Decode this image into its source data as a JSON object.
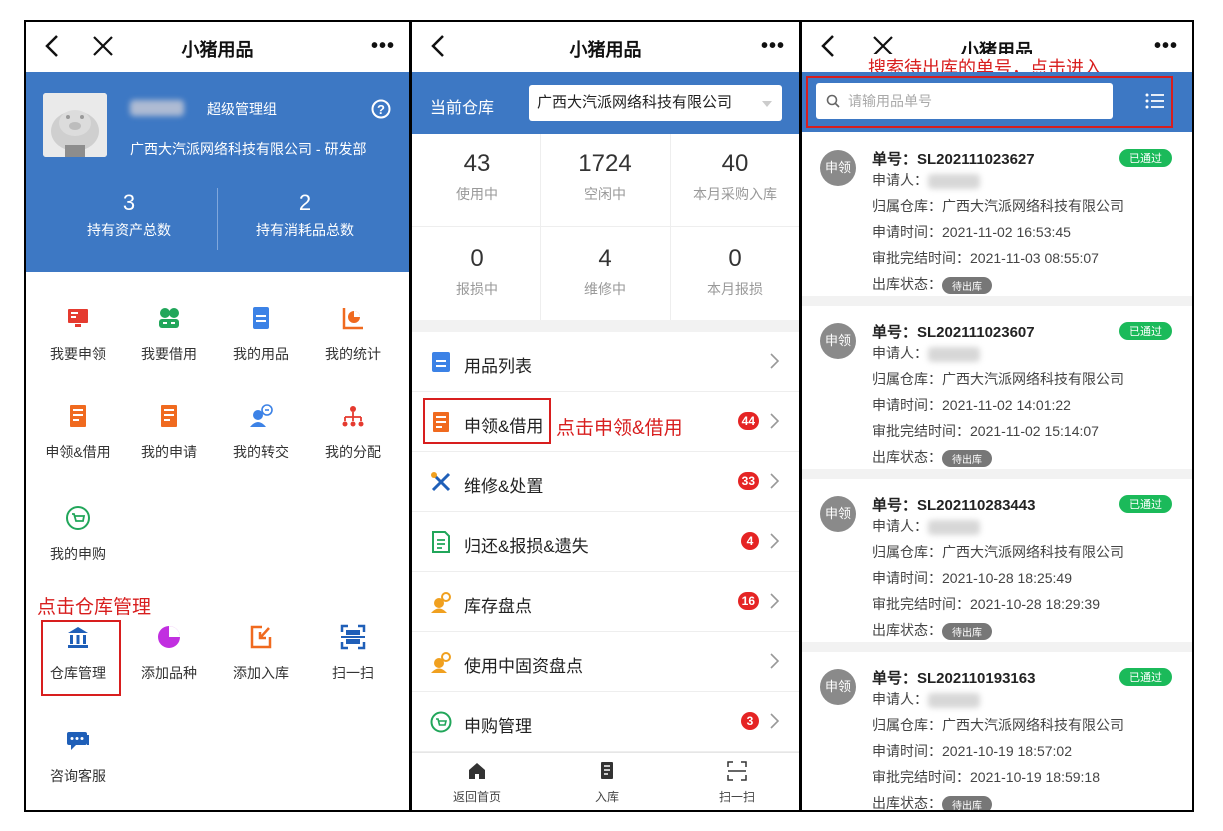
{
  "app_title": "小猪用品",
  "more": "•••",
  "panel1": {
    "role": "超级管理组",
    "company": "广西大汽派网络科技有限公司 - 研发部",
    "stats": [
      {
        "value": "3",
        "label": "持有资产总数"
      },
      {
        "value": "2",
        "label": "持有消耗品总数"
      }
    ],
    "grid": [
      {
        "label": "我要申领",
        "icon": "computer-icon",
        "color": "#e53a2f"
      },
      {
        "label": "我要借用",
        "icon": "users-icon",
        "color": "#21a65a"
      },
      {
        "label": "我的用品",
        "icon": "list-icon",
        "color": "#3c82e6"
      },
      {
        "label": "我的统计",
        "icon": "pie-chart-icon",
        "color": "#f06a1f"
      },
      {
        "label": "申领&借用",
        "icon": "form-icon",
        "color": "#f06a1f"
      },
      {
        "label": "我的申请",
        "icon": "form-icon",
        "color": "#f06a1f"
      },
      {
        "label": "我的转交",
        "icon": "transfer-icon",
        "color": "#3c82e6"
      },
      {
        "label": "我的分配",
        "icon": "org-icon",
        "color": "#e53a2f"
      },
      {
        "label": "我的申购",
        "icon": "cart-icon",
        "color": "#21a65a"
      },
      {
        "label": "仓库管理",
        "icon": "warehouse-icon",
        "color": "#1f5fb8"
      },
      {
        "label": "添加品种",
        "icon": "pie-icon",
        "color": "#c12fe0"
      },
      {
        "label": "添加入库",
        "icon": "import-icon",
        "color": "#f06a1f"
      },
      {
        "label": "扫一扫",
        "icon": "scan-icon",
        "color": "#1f5fb8"
      },
      {
        "label": "咨询客服",
        "icon": "chat-icon",
        "color": "#1f5fb8"
      }
    ],
    "annotation": "点击仓库管理"
  },
  "panel2": {
    "warehouse_label": "当前仓库",
    "warehouse_value": "广西大汽派网络科技有限公司",
    "stats": [
      {
        "value": "43",
        "label": "使用中"
      },
      {
        "value": "1724",
        "label": "空闲中"
      },
      {
        "value": "40",
        "label": "本月采购入库"
      },
      {
        "value": "0",
        "label": "报损中"
      },
      {
        "value": "4",
        "label": "维修中"
      },
      {
        "value": "0",
        "label": "本月报损"
      }
    ],
    "menu": [
      {
        "label": "用品列表",
        "badge": "",
        "icon": "list-icon",
        "color": "#3c82e6"
      },
      {
        "label": "申领&借用",
        "badge": "44",
        "icon": "form-icon",
        "color": "#f06a1f"
      },
      {
        "label": "维修&处置",
        "badge": "33",
        "icon": "tools-icon",
        "color": "#1f5fb8"
      },
      {
        "label": "归还&报损&遗失",
        "badge": "4",
        "icon": "doc-icon",
        "color": "#21a65a"
      },
      {
        "label": "库存盘点",
        "badge": "16",
        "icon": "inventory-icon",
        "color": "#f0a01f"
      },
      {
        "label": "使用中固资盘点",
        "badge": "",
        "icon": "inventory-icon",
        "color": "#f0a01f"
      },
      {
        "label": "申购管理",
        "badge": "3",
        "icon": "cart-icon",
        "color": "#21a65a"
      }
    ],
    "annotation": "点击申领&借用",
    "tabs": [
      {
        "label": "返回首页",
        "icon": "home-icon"
      },
      {
        "label": "入库",
        "icon": "book-icon"
      },
      {
        "label": "扫一扫",
        "icon": "scan-icon"
      }
    ]
  },
  "panel3": {
    "annotation": "搜索待出库的单号，点击进入",
    "search_placeholder": "请输用品单号",
    "orders": [
      {
        "type": "申领",
        "number": "单号：SL202111023627",
        "status": "已通过",
        "applicant": "申请人：",
        "warehouse": "归属仓库：广西大汽派网络科技有限公司",
        "apply_time": "申请时间：2021-11-02 16:53:45",
        "approve_time": "审批完结时间：2021-11-03 08:55:07",
        "out_label": "出库状态：",
        "out_status": "待出库"
      },
      {
        "type": "申领",
        "number": "单号：SL202111023607",
        "status": "已通过",
        "applicant": "申请人：",
        "warehouse": "归属仓库：广西大汽派网络科技有限公司",
        "apply_time": "申请时间：2021-11-02 14:01:22",
        "approve_time": "审批完结时间：2021-11-02 15:14:07",
        "out_label": "出库状态：",
        "out_status": "待出库"
      },
      {
        "type": "申领",
        "number": "单号：SL202110283443",
        "status": "已通过",
        "applicant": "申请人：",
        "warehouse": "归属仓库：广西大汽派网络科技有限公司",
        "apply_time": "申请时间：2021-10-28 18:25:49",
        "approve_time": "审批完结时间：2021-10-28 18:29:39",
        "out_label": "出库状态：",
        "out_status": "待出库"
      },
      {
        "type": "申领",
        "number": "单号：SL202110193163",
        "status": "已通过",
        "applicant": "申请人：",
        "warehouse": "归属仓库：广西大汽派网络科技有限公司",
        "apply_time": "申请时间：2021-10-19 18:57:02",
        "approve_time": "审批完结时间：2021-10-19 18:59:18",
        "out_label": "出库状态：",
        "out_status": "待出库"
      }
    ]
  }
}
